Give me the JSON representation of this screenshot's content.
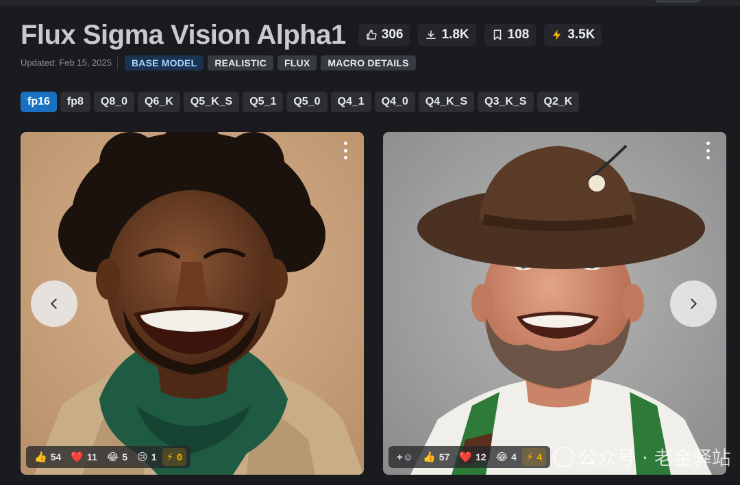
{
  "model": {
    "title": "Flux Sigma Vision Alpha1",
    "stats": {
      "likes": "306",
      "downloads": "1.8K",
      "saves": "108",
      "buzz": "3.5K"
    },
    "updated": "Updated: Feb 15, 2025",
    "tags": [
      "BASE MODEL",
      "REALISTIC",
      "FLUX",
      "MACRO DETAILS"
    ]
  },
  "versions": [
    "fp16",
    "fp8",
    "Q8_0",
    "Q6_K",
    "Q5_K_S",
    "Q5_1",
    "Q5_0",
    "Q4_1",
    "Q4_0",
    "Q4_K_S",
    "Q3_K_S",
    "Q2_K"
  ],
  "active_version": "fp16",
  "gallery": {
    "left": {
      "reactions": {
        "like": "54",
        "heart": "11",
        "laugh": "5",
        "cry": "1",
        "buzz": "0"
      }
    },
    "right": {
      "reactions": {
        "like": "57",
        "heart": "12",
        "laugh": "4",
        "buzz": "4"
      }
    }
  },
  "watermark": "公众号 · 老金驿站",
  "colors": {
    "background": "#1a1b1e",
    "active_version": "#1971c2",
    "base_tag_bg": "#1b3250",
    "base_tag_text": "#a5d8ff",
    "buzz": "#fab005"
  },
  "icons": [
    "thumb-up-icon",
    "download-icon",
    "bookmark-icon",
    "bolt-icon",
    "kebab-menu-icon",
    "chevron-left-icon",
    "chevron-right-icon",
    "add-reaction-icon"
  ]
}
